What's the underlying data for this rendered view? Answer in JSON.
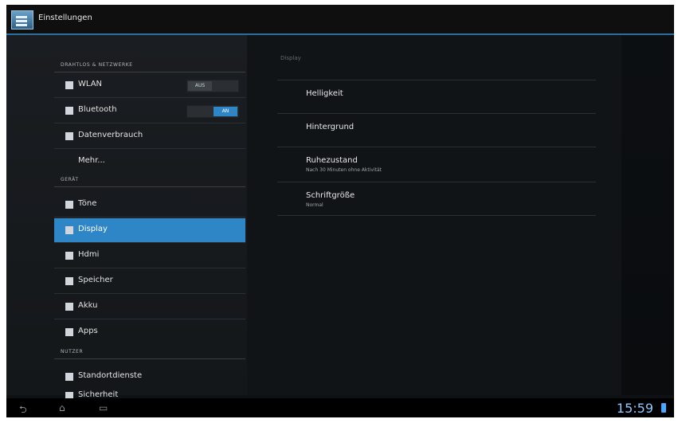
{
  "app": {
    "title": "Einstellungen"
  },
  "left": {
    "sections": [
      {
        "key": "wireless",
        "header": "DRAHTLOS & NETZWERKE"
      },
      {
        "key": "device",
        "header": "GERÄT"
      },
      {
        "key": "user",
        "header": "NUTZER"
      }
    ],
    "items": [
      {
        "key": "wlan",
        "label": "WLAN",
        "icon": "wifi-icon",
        "toggle": {
          "left": "AUS",
          "right": "",
          "state": "off"
        }
      },
      {
        "key": "bluetooth",
        "label": "Bluetooth",
        "icon": "bluetooth-icon",
        "toggle": {
          "left": "",
          "right": "AN",
          "state": "on"
        }
      },
      {
        "key": "data",
        "label": "Datenverbrauch",
        "icon": "data-usage-icon"
      },
      {
        "key": "more",
        "label": "Mehr..."
      },
      {
        "key": "sounds",
        "label": "Töne",
        "icon": "volume-icon"
      },
      {
        "key": "display",
        "label": "Display",
        "icon": "display-icon",
        "active": true
      },
      {
        "key": "hdmi",
        "label": "Hdmi",
        "icon": "hdmi-icon"
      },
      {
        "key": "storage",
        "label": "Speicher",
        "icon": "storage-icon"
      },
      {
        "key": "battery",
        "label": "Akku",
        "icon": "battery-icon"
      },
      {
        "key": "apps",
        "label": "Apps",
        "icon": "apps-icon"
      },
      {
        "key": "location",
        "label": "Standortdienste",
        "icon": "location-icon"
      },
      {
        "key": "security",
        "label": "Sicherheit",
        "icon": "lock-icon"
      }
    ]
  },
  "right": {
    "title": "Display",
    "prefs": [
      {
        "key": "brightness",
        "title": "Helligkeit",
        "summary": ""
      },
      {
        "key": "wallpaper",
        "title": "Hintergrund",
        "summary": ""
      },
      {
        "key": "sleep",
        "title": "Ruhezustand",
        "summary": "Nach 30 Minuten ohne Aktivität"
      },
      {
        "key": "fontsize",
        "title": "Schriftgröße",
        "summary": "Normal"
      }
    ]
  },
  "system": {
    "time": "15:59",
    "nav": [
      "back-icon",
      "home-icon",
      "recents-icon"
    ]
  },
  "colors": {
    "accent": "#2f86c7"
  }
}
